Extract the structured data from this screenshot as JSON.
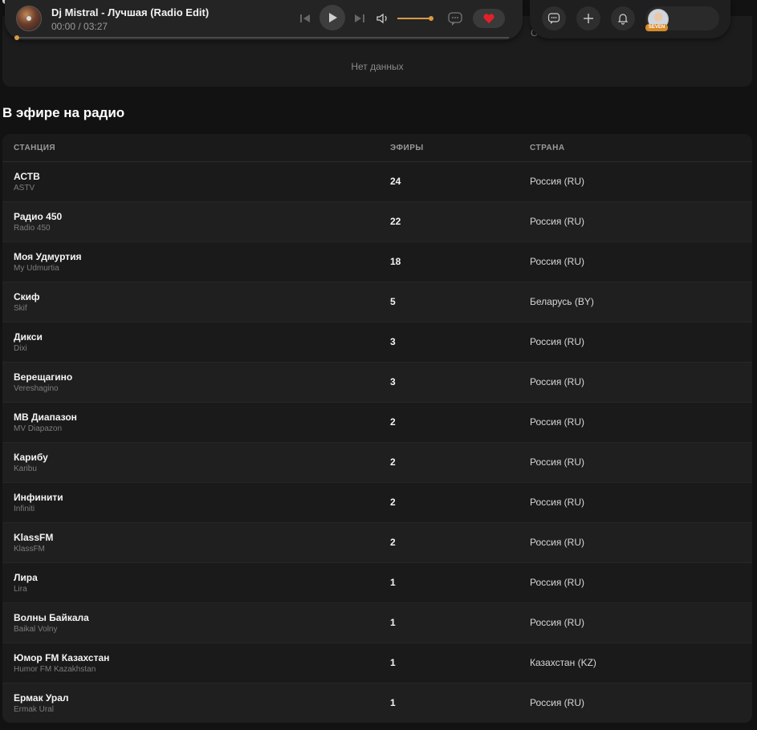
{
  "player": {
    "title": "Dj Mistral - Лучшая (Radio Edit)",
    "time": "00:00 / 03:27",
    "progress": 0.0,
    "volume": 1.0,
    "accent": "#d99a45",
    "icons": [
      "skip-back-icon",
      "play-icon",
      "skip-forward-icon",
      "volume-icon",
      "chat-icon",
      "heart-icon"
    ]
  },
  "header": {
    "icons": [
      "chat-icon",
      "plus-icon",
      "bell-icon"
    ],
    "user_badge": "SEVEN"
  },
  "previous_section": {
    "empty_text": "Нет данных",
    "cut_text": "С"
  },
  "radio_section": {
    "title": "В эфире на радио",
    "columns": [
      "СТАНЦИЯ",
      "ЭФИРЫ",
      "СТРАНА"
    ],
    "rows": [
      {
        "name": "АСТВ",
        "sub": "ASTV",
        "plays": "24",
        "country": "Россия (RU)"
      },
      {
        "name": "Радио 450",
        "sub": "Radio 450",
        "plays": "22",
        "country": "Россия (RU)"
      },
      {
        "name": "Моя Удмуртия",
        "sub": "My Udmurtia",
        "plays": "18",
        "country": "Россия (RU)"
      },
      {
        "name": "Скиф",
        "sub": "Skif",
        "plays": "5",
        "country": "Беларусь (BY)"
      },
      {
        "name": "Дикси",
        "sub": "Dixi",
        "plays": "3",
        "country": "Россия (RU)"
      },
      {
        "name": "Верещагино",
        "sub": "Vereshagino",
        "plays": "3",
        "country": "Россия (RU)"
      },
      {
        "name": "МВ Диапазон",
        "sub": "MV Diapazon",
        "plays": "2",
        "country": "Россия (RU)"
      },
      {
        "name": "Карибу",
        "sub": "Karibu",
        "plays": "2",
        "country": "Россия (RU)"
      },
      {
        "name": "Инфинити",
        "sub": "Infiniti",
        "plays": "2",
        "country": "Россия (RU)"
      },
      {
        "name": "KlassFM",
        "sub": "KlassFM",
        "plays": "2",
        "country": "Россия (RU)"
      },
      {
        "name": "Лира",
        "sub": "Lira",
        "plays": "1",
        "country": "Россия (RU)"
      },
      {
        "name": "Волны Байкала",
        "sub": "Baikal Volny",
        "plays": "1",
        "country": "Россия (RU)"
      },
      {
        "name": "Юмор FM Казахстан",
        "sub": "Humor FM Kazakhstan",
        "plays": "1",
        "country": "Казахстан (KZ)"
      },
      {
        "name": "Ермак Урал",
        "sub": "Ermak Ural",
        "plays": "1",
        "country": "Россия (RU)"
      }
    ]
  }
}
